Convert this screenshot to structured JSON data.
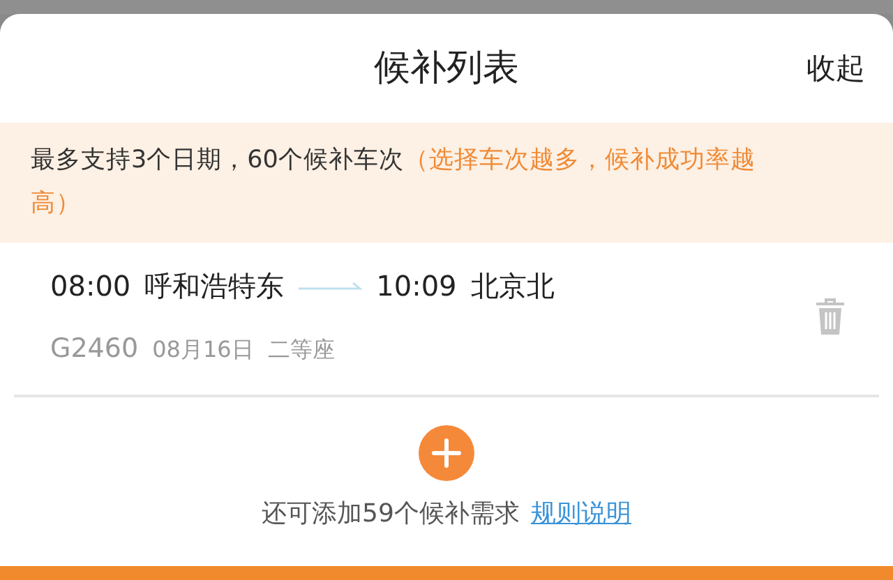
{
  "header": {
    "title": "候补列表",
    "collapse": "收起"
  },
  "notice": {
    "text": "最多支持3个日期，60个候补车次",
    "highlight": "（选择车次越多，候补成功率越高）"
  },
  "trains": [
    {
      "depart_time": "08:00",
      "from": "呼和浩特东",
      "arrive_time": "10:09",
      "to": "北京北",
      "train_no": "G2460",
      "date": "08月16日",
      "seat": "二等座"
    }
  ],
  "footer": {
    "remaining": "还可添加59个候补需求",
    "link": "规则说明"
  }
}
